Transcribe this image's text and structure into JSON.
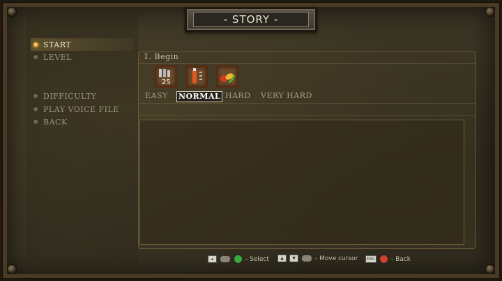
{
  "header": {
    "title": "- STORY -"
  },
  "menu": {
    "items": [
      {
        "label": "START",
        "active": true
      },
      {
        "label": "LEVEL",
        "active": false
      },
      {
        "label": "DIFFICULTY",
        "active": false
      },
      {
        "label": "PLAY VOICE FILE",
        "active": false
      },
      {
        "label": "BACK",
        "active": false
      }
    ]
  },
  "level": {
    "value": "1. Begin",
    "icons": [
      {
        "name": "ammo-25-icon",
        "text": "25"
      },
      {
        "name": "potion-icon"
      },
      {
        "name": "vegetables-icon"
      }
    ]
  },
  "difficulty": {
    "options": [
      "EASY",
      "NORMAL",
      "HARD",
      "VERY HARD"
    ],
    "selected": "NORMAL"
  },
  "footer": {
    "select_label": "- Select",
    "move_label": "- Move cursor",
    "back_label": "- Back"
  },
  "colors": {
    "accent": "#e8a020",
    "button_a": "#3aaa3a",
    "button_b": "#d04030"
  }
}
